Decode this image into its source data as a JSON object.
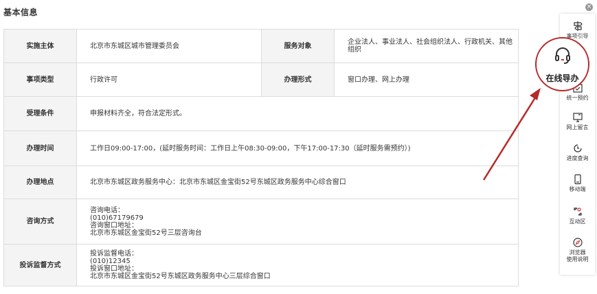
{
  "section_title": "基本信息",
  "rows": [
    {
      "label": "实施主体",
      "value": "北京市东城区城市管理委员会",
      "label2": "服务对象",
      "value2": "企业法人、事业法人、社会组织法人、行政机关、其他组织"
    },
    {
      "label": "事项类型",
      "value": "行政许可",
      "label2": "办理形式",
      "value2": "窗口办理、网上办理"
    },
    {
      "label": "受理条件",
      "value": "申报材料齐全，符合法定形式。"
    },
    {
      "label": "办理时间",
      "value": "工作日09:00-17:00，(延时服务时间：工作日上午08:30-09:00，下午17:00-17:30（延时服务需预约）)"
    },
    {
      "label": "办理地点",
      "value": "北京市东城区政务服务中心：北京市东城区金宝街52号东城区政务服务中心综合窗口"
    },
    {
      "label": "咨询方式",
      "lines": [
        "咨询电话：",
        "(010)67179679",
        "咨询窗口地址：",
        "北京市东城区金宝街52号三层咨询台"
      ]
    },
    {
      "label": "投诉监督方式",
      "lines": [
        "投诉监督电话：",
        "(010)12345",
        "投诉窗口地址：",
        "北京市东城区金宝街52号东城区政务服务中心三层综合窗口"
      ]
    }
  ],
  "sidebar": {
    "close": "×",
    "items": [
      {
        "label": "事项引导",
        "icon": "signpost-icon"
      },
      {
        "label": "统一预约",
        "icon": "calendar-icon"
      },
      {
        "label": "网上留言",
        "icon": "message-edit-icon"
      },
      {
        "label": "进度查询",
        "icon": "progress-clock-icon"
      },
      {
        "label": "移动端",
        "icon": "mobile-icon"
      },
      {
        "label": "互动区",
        "icon": "interact-icon"
      },
      {
        "label": "浏览器",
        "label_line2": "使用说明",
        "icon": "compass-icon"
      }
    ],
    "highlight": {
      "label": "在线导办",
      "icon": "headset-icon"
    }
  },
  "colors": {
    "accent": "#b52a2a",
    "label_bg": "#f4f4f4",
    "border": "#dcdcdc"
  }
}
